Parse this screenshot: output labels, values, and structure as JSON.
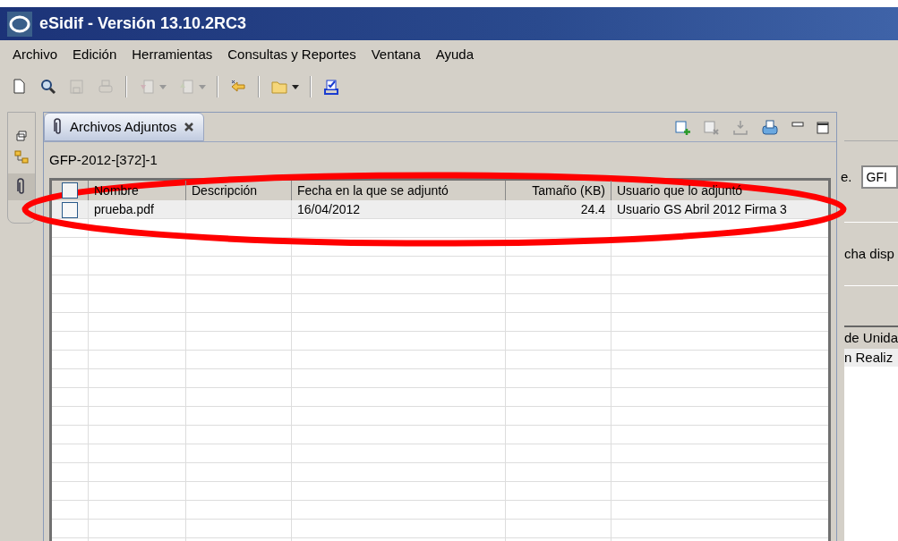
{
  "window": {
    "title": "eSidif - Versión 13.10.2RC3"
  },
  "menu": [
    {
      "label": "Archivo"
    },
    {
      "label": "Edición"
    },
    {
      "label": "Herramientas"
    },
    {
      "label": "Consultas y Reportes"
    },
    {
      "label": "Ventana"
    },
    {
      "label": "Ayuda"
    }
  ],
  "toolbar": [
    {
      "kind": "new",
      "disabled": false
    },
    {
      "kind": "search",
      "disabled": false
    },
    {
      "kind": "save",
      "disabled": true
    },
    {
      "kind": "print",
      "disabled": true
    },
    {
      "kind": "sep"
    },
    {
      "kind": "import",
      "disabled": true
    },
    {
      "kind": "export",
      "disabled": true
    },
    {
      "kind": "sep"
    },
    {
      "kind": "back",
      "disabled": false
    },
    {
      "kind": "sep"
    },
    {
      "kind": "folder",
      "disabled": false
    },
    {
      "kind": "sep"
    },
    {
      "kind": "task",
      "disabled": false
    }
  ],
  "view": {
    "tab": {
      "label": "Archivos Adjuntos",
      "selected": true
    },
    "record": "GFP-2012-[372]-1",
    "table": {
      "header_checked": false,
      "columns": [
        "Nombre",
        "Descripción",
        "Fecha en la que se adjuntó",
        "Tamaño (KB)",
        "Usuario que lo adjuntó"
      ],
      "rows": [
        {
          "checked": false,
          "nombre": "prueba.pdf",
          "fecha": "16/04/2012",
          "tamano": "24.4",
          "usuario": "Usuario GS Abril 2012 Firma 3"
        }
      ]
    }
  },
  "right_panel": {
    "label_1": "e.",
    "field_value": "GFI",
    "label_2": "cha disp",
    "column_header": "de Unida",
    "row_1": "n Realiz"
  },
  "annotation": {
    "kind": "ellipse"
  }
}
